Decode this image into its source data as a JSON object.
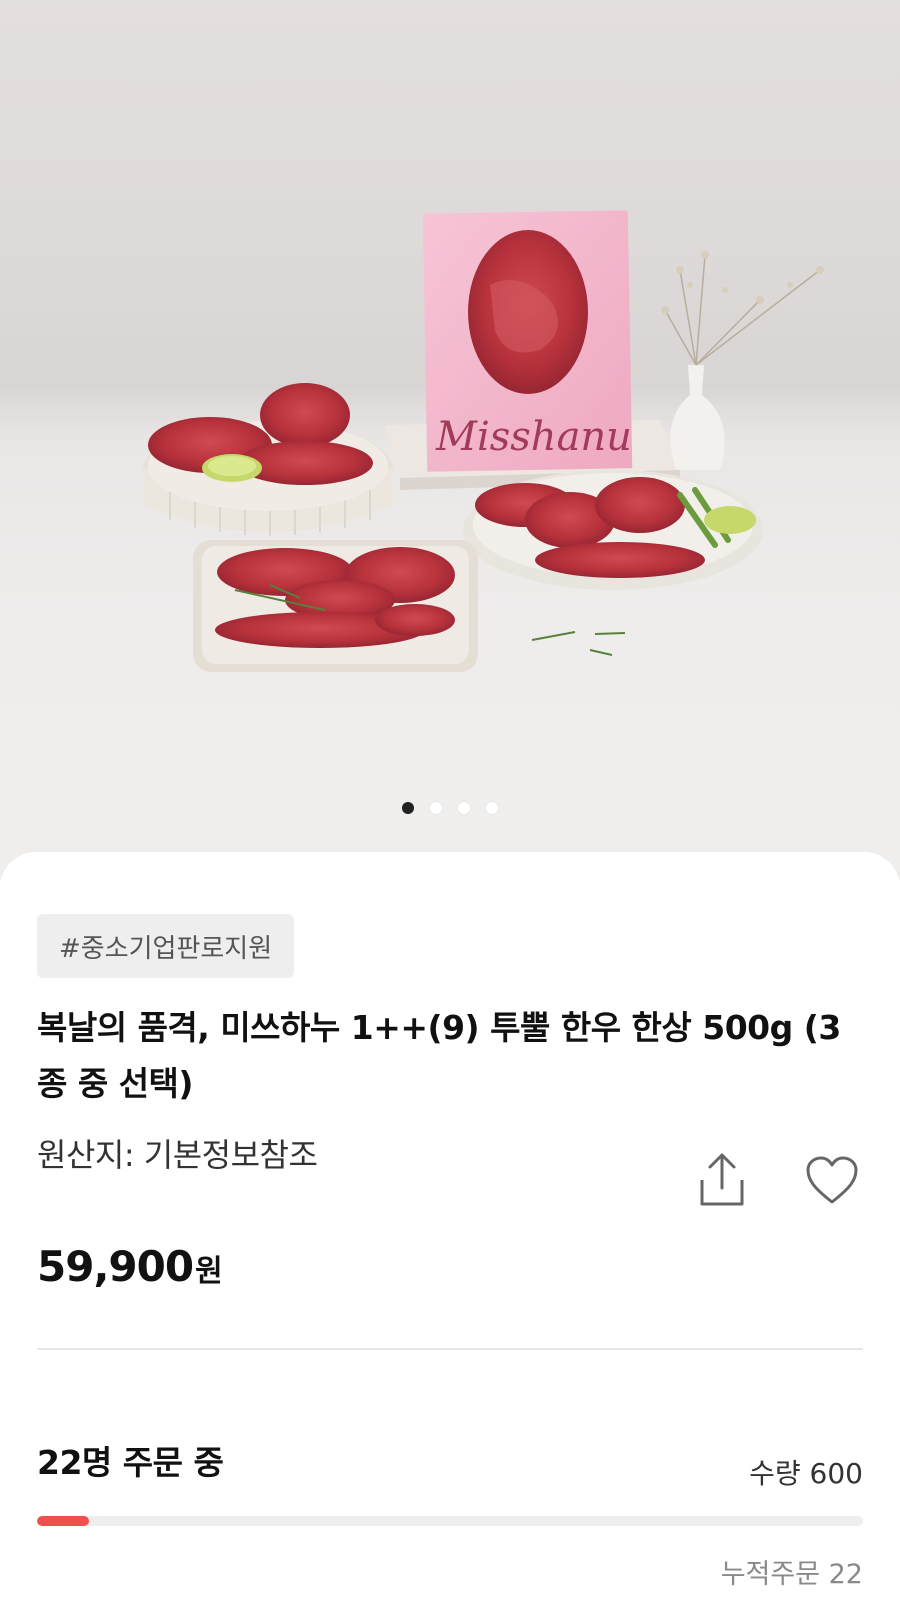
{
  "hero": {
    "box_brand_text": "Misshanu",
    "carousel": {
      "total": 4,
      "active_index": 0
    }
  },
  "product": {
    "tag": "#중소기업판로지원",
    "title": "복날의 품격, 미쓰하누 1++(9) 투뿔 한우 한상 500g (3종 중 선택)",
    "origin": "원산지: 기본정보참조",
    "price": "59,900",
    "currency": "원"
  },
  "order_status": {
    "ordering_text": "22명 주문 중",
    "quantity_text": "수량 600",
    "cumulative_text": "누적주문 22",
    "progress_fraction": 0.063
  },
  "colors": {
    "accent": "#f0504a",
    "box_pink": "#f3b3c9",
    "meat_red": "#b8323c"
  },
  "icons": {
    "share": "share-icon",
    "heart": "heart-icon"
  }
}
